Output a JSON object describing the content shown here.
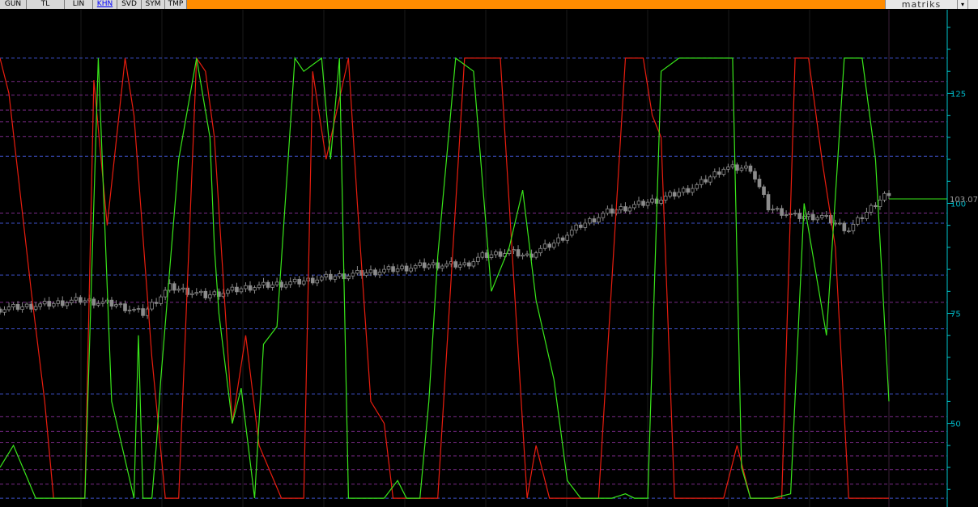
{
  "toolbar": {
    "tabs": [
      {
        "label": "GUN",
        "active": false
      },
      {
        "label": "TL",
        "active": false
      },
      {
        "label": "LIN",
        "active": false
      },
      {
        "label": "KHN",
        "active": true
      },
      {
        "label": "SVD",
        "active": false
      },
      {
        "label": "SYM",
        "active": false
      },
      {
        "label": "TMP",
        "active": false
      }
    ],
    "brand": "matriks",
    "menu_caret": "▾"
  },
  "chart_data": {
    "type": "line",
    "ylim": [
      31,
      144
    ],
    "yticks": [
      50,
      75,
      100,
      125
    ],
    "last_value_label": "103.07",
    "colors": {
      "background": "#000000",
      "axis": "#00c8d0",
      "price": "#8c8c8c",
      "line_a": "#e81d0e",
      "line_b": "#39e61a",
      "grid_blue": "#3e50c8",
      "grid_purple": "#7a2a88"
    },
    "hlines_blue": [
      33,
      56.7,
      71.5,
      83.7,
      95.5,
      110.7,
      133
    ],
    "hlines_purple": [
      36.2,
      39.5,
      42.6,
      45.6,
      48.2,
      51.5,
      77.5,
      97.8,
      115.2,
      118.5,
      121.2,
      124.6,
      127.7
    ],
    "x_count": 200,
    "price": {
      "name": "",
      "x": [
        0,
        10,
        18,
        26,
        32,
        36,
        38,
        46,
        56,
        66,
        72,
        80,
        88,
        96,
        104,
        108,
        114,
        118,
        124,
        130,
        136,
        140,
        148,
        156,
        162,
        168,
        172,
        178,
        184,
        190,
        198,
        199
      ],
      "y": [
        76,
        77,
        78,
        77,
        75,
        79,
        81,
        79,
        81,
        82,
        83,
        84,
        85,
        86,
        86,
        88,
        89,
        88,
        91,
        95,
        98,
        99,
        101,
        104,
        108,
        108,
        99,
        97,
        97,
        94,
        102,
        101
      ]
    },
    "line_a": {
      "name": "",
      "x": [
        0,
        2,
        7,
        10,
        12,
        14,
        19,
        21,
        24,
        28,
        30,
        34,
        37,
        40,
        44,
        46,
        48,
        52,
        55,
        58,
        63,
        68,
        70,
        73,
        78,
        80,
        83,
        86,
        88,
        92,
        98,
        104,
        112,
        118,
        120,
        123,
        126,
        130,
        134,
        140,
        144,
        146,
        148,
        151,
        154,
        158,
        162,
        165,
        168,
        170,
        175,
        178,
        181,
        184,
        187,
        190,
        194,
        197,
        199
      ],
      "y": [
        133,
        125,
        80,
        55,
        33,
        33,
        33,
        128,
        95,
        133,
        120,
        65,
        33,
        33,
        133,
        130,
        115,
        50,
        70,
        45,
        33,
        33,
        130,
        110,
        133,
        100,
        55,
        50,
        33,
        33,
        33,
        133,
        133,
        33,
        45,
        33,
        33,
        33,
        33,
        133,
        133,
        120,
        115,
        33,
        33,
        33,
        33,
        45,
        33,
        33,
        33,
        133,
        133,
        110,
        90,
        33,
        33,
        33,
        33
      ]
    },
    "line_b": {
      "name": "",
      "x": [
        0,
        3,
        8,
        13,
        16,
        19,
        22,
        25,
        30,
        31,
        32,
        34,
        35,
        36,
        40,
        44,
        47,
        48,
        49,
        52,
        54,
        57,
        59,
        62,
        66,
        68,
        72,
        74,
        76,
        78,
        82,
        86,
        89,
        91,
        94,
        96,
        98,
        102,
        106,
        110,
        114,
        117,
        120,
        124,
        127,
        130,
        134,
        137,
        140,
        142,
        145,
        148,
        152,
        156,
        160,
        164,
        166,
        168,
        170,
        173,
        177,
        180,
        185,
        189,
        193,
        196,
        199
      ],
      "y": [
        40,
        45,
        33,
        33,
        33,
        33,
        133,
        55,
        33,
        70,
        33,
        33,
        45,
        60,
        110,
        133,
        115,
        90,
        75,
        50,
        58,
        33,
        68,
        72,
        133,
        130,
        133,
        110,
        133,
        33,
        33,
        33,
        37,
        33,
        33,
        55,
        88,
        133,
        130,
        80,
        90,
        103,
        78,
        60,
        37,
        33,
        33,
        33,
        34,
        33,
        33,
        130,
        133,
        133,
        133,
        133,
        40,
        33,
        33,
        33,
        34,
        100,
        70,
        133,
        133,
        110,
        55
      ]
    }
  }
}
